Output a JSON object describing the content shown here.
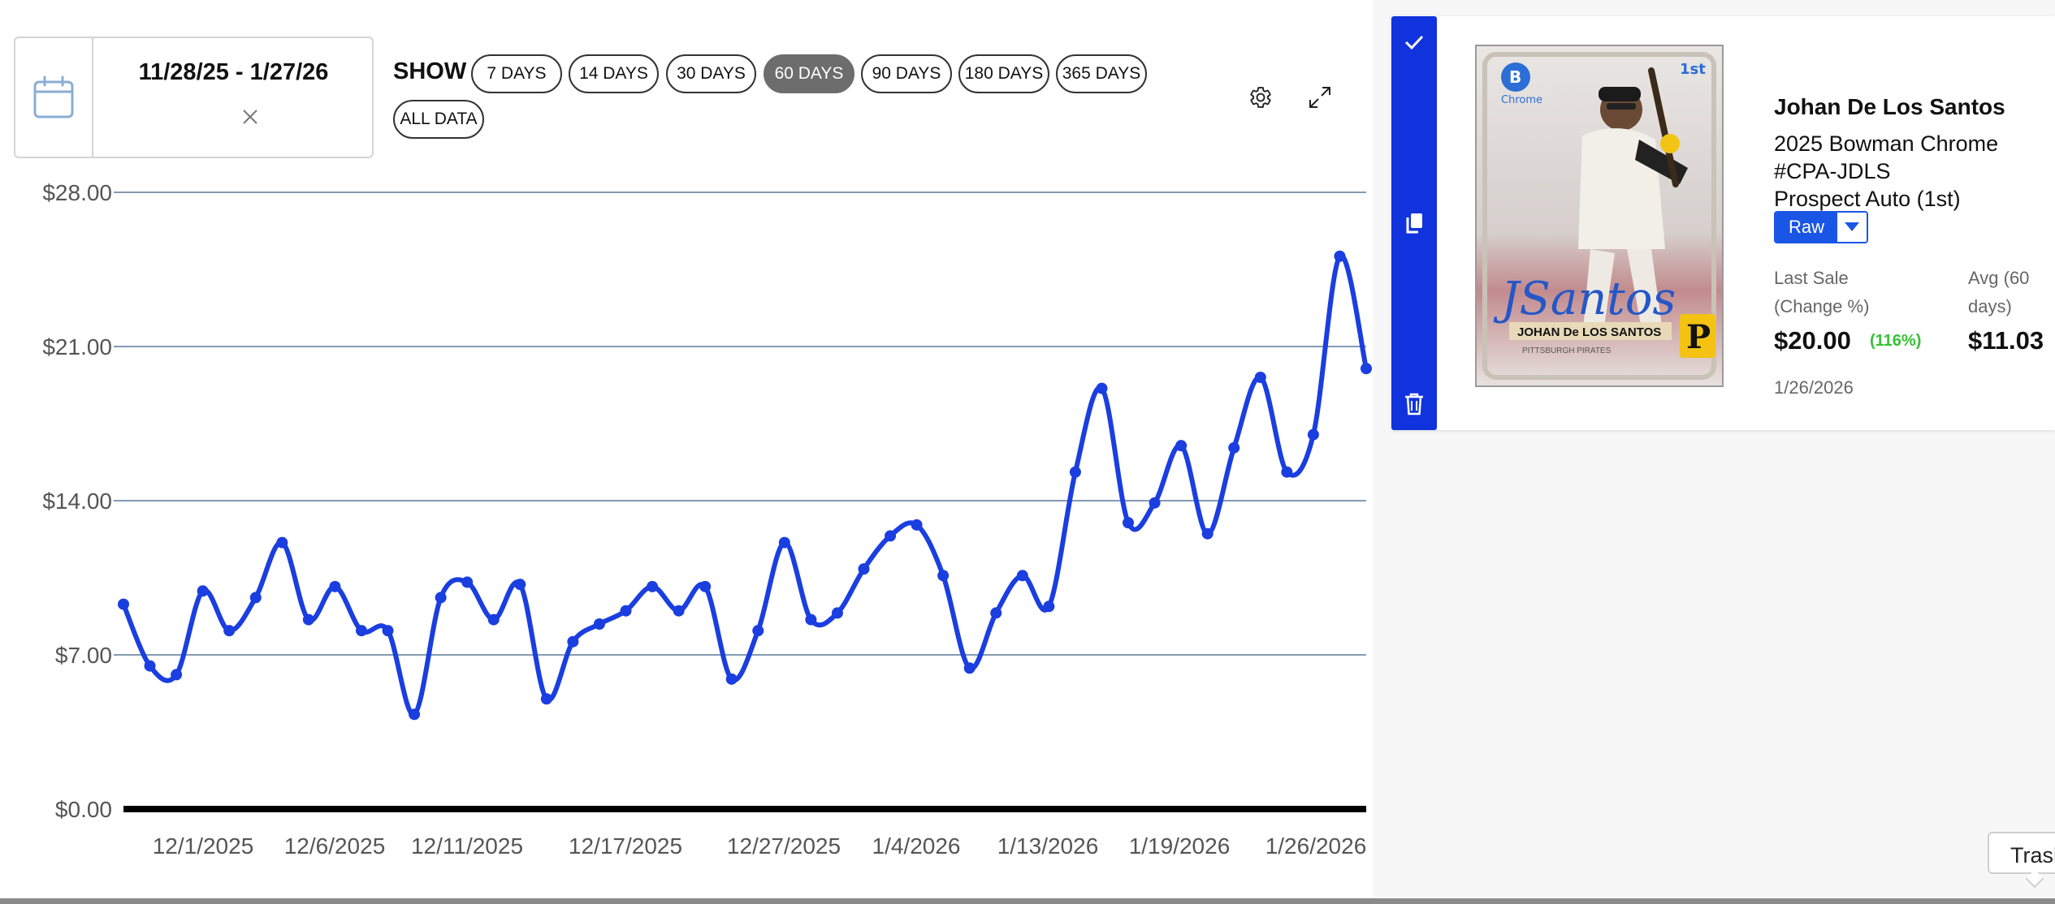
{
  "date_filter": {
    "range": "11/28/25 - 1/27/26",
    "icon": "calendar-icon",
    "clear_icon": "close-icon"
  },
  "show": {
    "label": "SHOW",
    "options": [
      "7 DAYS",
      "14 DAYS",
      "30 DAYS",
      "60 DAYS",
      "90 DAYS",
      "180 DAYS",
      "365 DAYS",
      "ALL DATA"
    ],
    "active": "60 DAYS"
  },
  "toolbar": {
    "settings_icon": "gear-icon",
    "expand_icon": "expand-icon"
  },
  "colors": {
    "line": "#1a3ee0",
    "grid": "#5c7a9a",
    "action_strip": "#1133dd",
    "active_pill": "#6d6d6d",
    "change_positive": "#35c235",
    "condition": "#1a56e6"
  },
  "chart_data": {
    "type": "line",
    "xlabel": "",
    "ylabel": "",
    "ylim": [
      0,
      28
    ],
    "y_ticks": [
      "$0.00",
      "$7.00",
      "$14.00",
      "$21.00",
      "$28.00"
    ],
    "x_tick_labels": [
      "12/1/2025",
      "12/6/2025",
      "12/11/2025",
      "12/17/2025",
      "12/27/2025",
      "1/4/2026",
      "1/13/2026",
      "1/19/2026",
      "1/26/2026"
    ],
    "grid": true,
    "series": [
      {
        "values": [
          9.3,
          6.5,
          6.1,
          9.9,
          8.1,
          9.6,
          12.1,
          8.6,
          10.1,
          8.1,
          8.1,
          4.3,
          9.6,
          10.3,
          8.6,
          10.2,
          5.0,
          7.6,
          8.4,
          9.0,
          10.1,
          9.0,
          10.1,
          5.9,
          8.1,
          12.1,
          8.6,
          8.9,
          10.9,
          12.4,
          12.9,
          10.6,
          6.4,
          8.9,
          10.6,
          9.2,
          15.3,
          19.1,
          13.0,
          13.9,
          16.5,
          12.5,
          16.4,
          19.6,
          15.3,
          17.0,
          25.1,
          20.0
        ]
      }
    ]
  },
  "card": {
    "player": "Johan De Los Santos",
    "set_line1": "2025 Bowman Chrome",
    "set_line2": "#CPA-JDLS",
    "set_line3": "Prospect Auto (1st)",
    "condition": "Raw",
    "image_text": {
      "brand": "Chrome",
      "first": "1st",
      "signature": "JSantos",
      "nameplate": "JOHAN De LOS SANTOS",
      "team_line": "PITTSBURGH PIRATES"
    },
    "last_sale_label_1": "Last Sale",
    "last_sale_label_2": "(Change %)",
    "last_sale_value": "$20.00",
    "last_sale_change": "(116%)",
    "avg_label_1": "Avg (60",
    "avg_label_2": "days)",
    "avg_value": "$11.03",
    "last_sale_date": "1/26/2026",
    "actions": [
      "check-icon",
      "copy-icon",
      "trash-icon"
    ]
  },
  "tooltip": {
    "text": "Trash"
  }
}
